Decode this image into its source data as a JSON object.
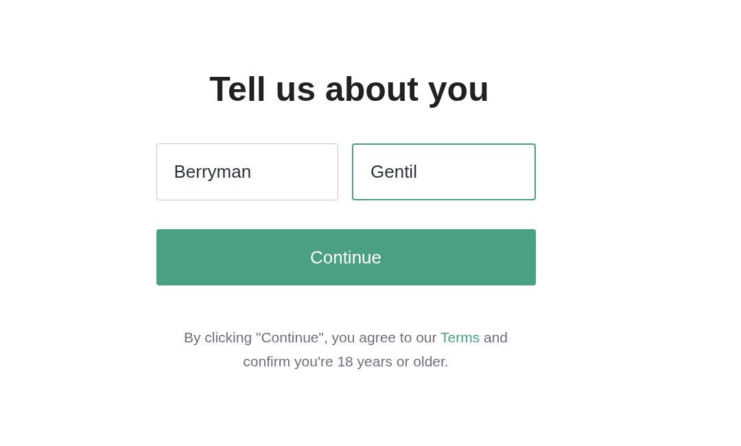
{
  "title": "Tell us about you",
  "fields": [
    {
      "value": "Berryman",
      "focused": false
    },
    {
      "value": "Gentil",
      "focused": true
    }
  ],
  "button": {
    "label": "Continue"
  },
  "disclaimer": {
    "before": "By clicking \"Continue\", you agree to our ",
    "link": "Terms",
    "after": " and confirm you're 18 years or older."
  }
}
